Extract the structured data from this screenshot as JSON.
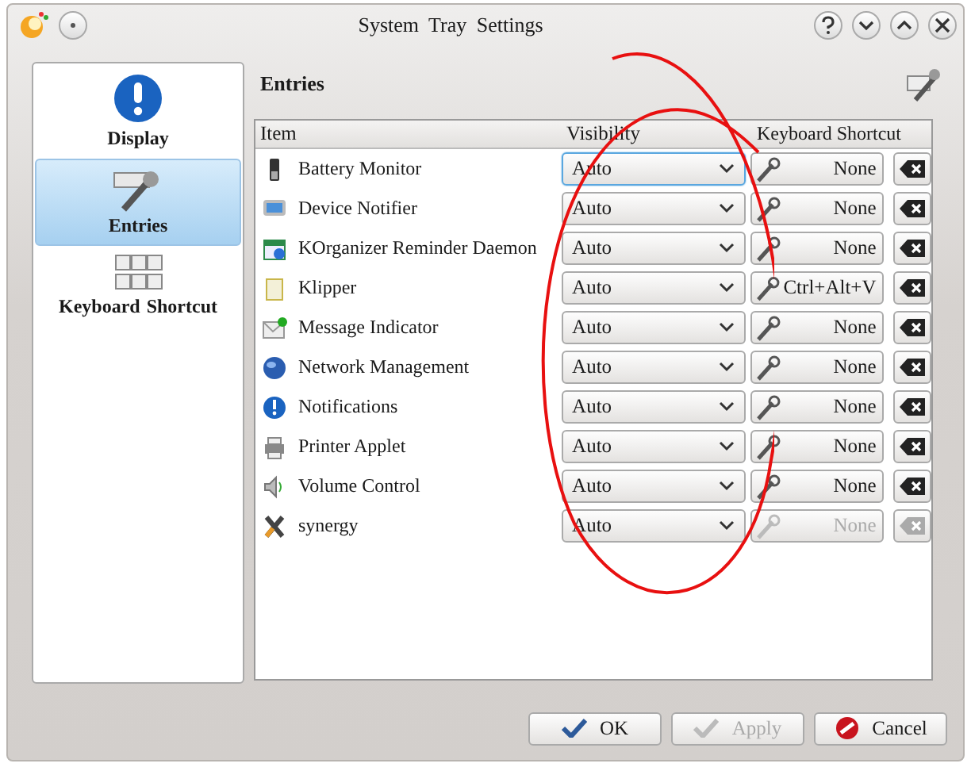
{
  "window": {
    "title": "System Tray Settings"
  },
  "sidebar": {
    "items": [
      {
        "label": "Display",
        "selected": false
      },
      {
        "label": "Entries",
        "selected": true
      },
      {
        "label": "Keyboard Shortcut",
        "selected": false
      }
    ]
  },
  "page": {
    "heading": "Entries"
  },
  "table": {
    "columns": [
      "Item",
      "Visibility",
      "Keyboard Shortcut"
    ],
    "rows": [
      {
        "item": "Battery Monitor",
        "visibility": "Auto",
        "focused": true,
        "shortcut": "None",
        "disabled": false
      },
      {
        "item": "Device Notifier",
        "visibility": "Auto",
        "focused": false,
        "shortcut": "None",
        "disabled": false
      },
      {
        "item": "KOrganizer Reminder Daemon",
        "visibility": "Auto",
        "focused": false,
        "shortcut": "None",
        "disabled": false
      },
      {
        "item": "Klipper",
        "visibility": "Auto",
        "focused": false,
        "shortcut": "Ctrl+Alt+V",
        "disabled": false
      },
      {
        "item": "Message Indicator",
        "visibility": "Auto",
        "focused": false,
        "shortcut": "None",
        "disabled": false
      },
      {
        "item": "Network Management",
        "visibility": "Auto",
        "focused": false,
        "shortcut": "None",
        "disabled": false
      },
      {
        "item": "Notifications",
        "visibility": "Auto",
        "focused": false,
        "shortcut": "None",
        "disabled": false
      },
      {
        "item": "Printer Applet",
        "visibility": "Auto",
        "focused": false,
        "shortcut": "None",
        "disabled": false
      },
      {
        "item": "Volume Control",
        "visibility": "Auto",
        "focused": false,
        "shortcut": "None",
        "disabled": false
      },
      {
        "item": "synergy",
        "visibility": "Auto",
        "focused": false,
        "shortcut": "None",
        "disabled": true
      }
    ]
  },
  "buttons": [
    {
      "label": "OK",
      "kind": "ok",
      "disabled": false
    },
    {
      "label": "Apply",
      "kind": "apply",
      "disabled": true
    },
    {
      "label": "Cancel",
      "kind": "cancel",
      "disabled": false
    }
  ]
}
